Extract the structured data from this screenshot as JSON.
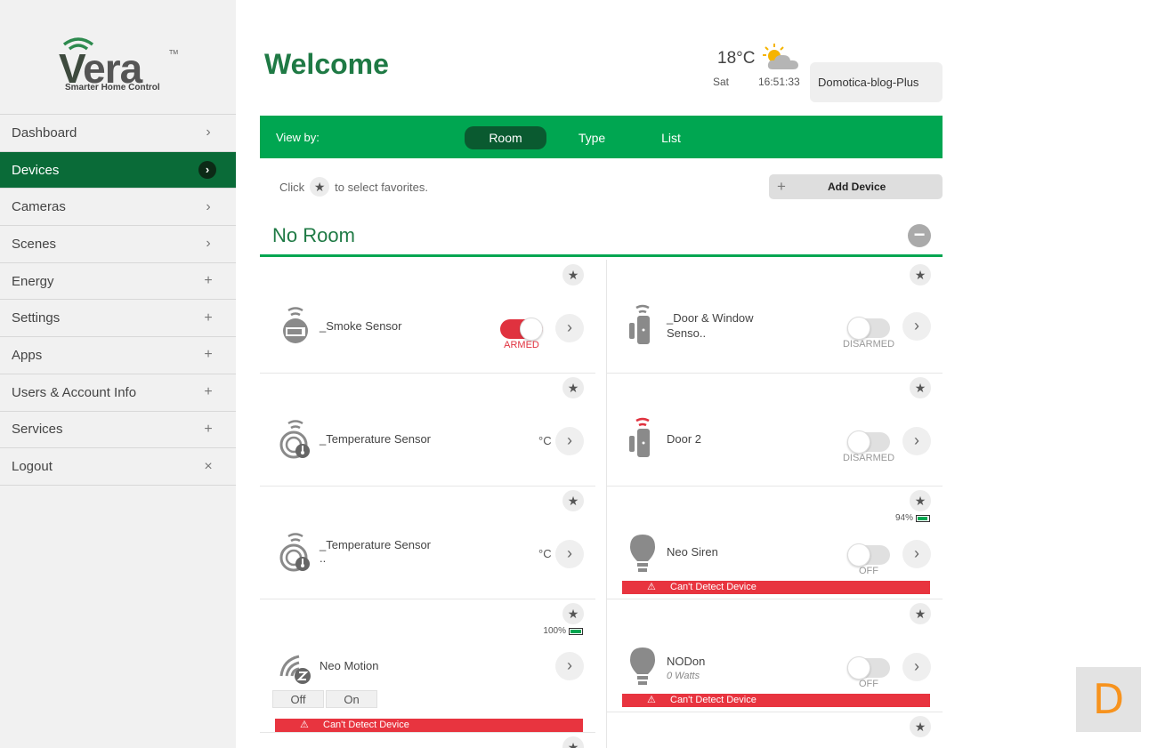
{
  "brand": {
    "name_v": "V",
    "name_rest": "era",
    "trademark": "TM",
    "tagline": "Smarter Home Control"
  },
  "sidebar": {
    "items": [
      {
        "label": "Dashboard",
        "indicator": "›"
      },
      {
        "label": "Devices",
        "indicator": "›",
        "active": true
      },
      {
        "label": "Cameras",
        "indicator": "›"
      },
      {
        "label": "Scenes",
        "indicator": "›"
      },
      {
        "label": "Energy",
        "indicator": "+"
      },
      {
        "label": "Settings",
        "indicator": "+"
      },
      {
        "label": "Apps",
        "indicator": "+"
      },
      {
        "label": "Users & Account Info",
        "indicator": "+"
      },
      {
        "label": "Services",
        "indicator": "+"
      },
      {
        "label": "Logout",
        "indicator": "×"
      }
    ]
  },
  "header": {
    "title": "Welcome",
    "temperature": "18°C",
    "day": "Sat",
    "time": "16:51:33",
    "controller": "Domotica-blog-Plus"
  },
  "viewbar": {
    "label": "View by:",
    "tabs": [
      {
        "label": "Room",
        "active": true
      },
      {
        "label": "Type"
      },
      {
        "label": "List"
      }
    ]
  },
  "favorites_hint": {
    "prefix": "Click",
    "suffix": "to select favorites."
  },
  "add_device": {
    "plus": "+",
    "label": "Add Device"
  },
  "room": {
    "title": "No Room",
    "collapse": "−"
  },
  "devices": [
    {
      "name": "_Smoke Sensor",
      "state": "ARMED"
    },
    {
      "name": "_Door & Window",
      "name2": "Senso..",
      "state": "DISARMED"
    },
    {
      "name": "_Temperature Sensor",
      "unit": "°C"
    },
    {
      "name": "Door 2",
      "state": "DISARMED"
    },
    {
      "name": "_Temperature Sensor",
      "name2": "..",
      "unit": "°C"
    },
    {
      "name": "Neo Siren",
      "state": "OFF",
      "battery": "94%",
      "alert": "Can't Detect Device"
    },
    {
      "name": "Neo Motion",
      "battery": "100%",
      "off_label": "Off",
      "on_label": "On",
      "alert": "Can't Detect Device"
    },
    {
      "name": "NODon",
      "sub": "0 Watts",
      "state": "OFF",
      "alert": "Can't Detect Device"
    }
  ],
  "icons": {
    "star": "★",
    "arrow": "›",
    "warning": "⚠"
  },
  "colors": {
    "accent_green": "#00a651",
    "dark_green": "#0a6b38",
    "alert_red": "#e8343f",
    "title_green": "#1f7a45"
  },
  "watermark": "D"
}
